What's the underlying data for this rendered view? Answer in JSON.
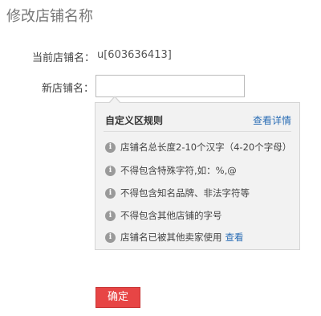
{
  "page": {
    "title": "修改店铺名称"
  },
  "form": {
    "current_label": "当前店铺名：",
    "current_value": "u[603636413]",
    "new_label": "新店铺名：",
    "new_value": "",
    "new_placeholder": ""
  },
  "rules_panel": {
    "heading": "自定义区规则",
    "details_link": "查看详情",
    "icon": "info-icon",
    "rules": [
      {
        "text": "店铺名总长度2-10个汉字（4-20个字母）",
        "link": ""
      },
      {
        "text": "不得包含特殊字符,如：%,@",
        "link": ""
      },
      {
        "text": "不得包含知名品牌、非法字符等",
        "link": ""
      },
      {
        "text": "不得包含其他店铺的字号",
        "link": ""
      },
      {
        "text": "店铺名已被其他卖家使用",
        "link": "查看"
      }
    ]
  },
  "actions": {
    "confirm_label": "确定"
  },
  "colors": {
    "accent_link": "#2a6db5",
    "confirm_button": "#e74545",
    "panel_bg": "#f2f2f2"
  }
}
